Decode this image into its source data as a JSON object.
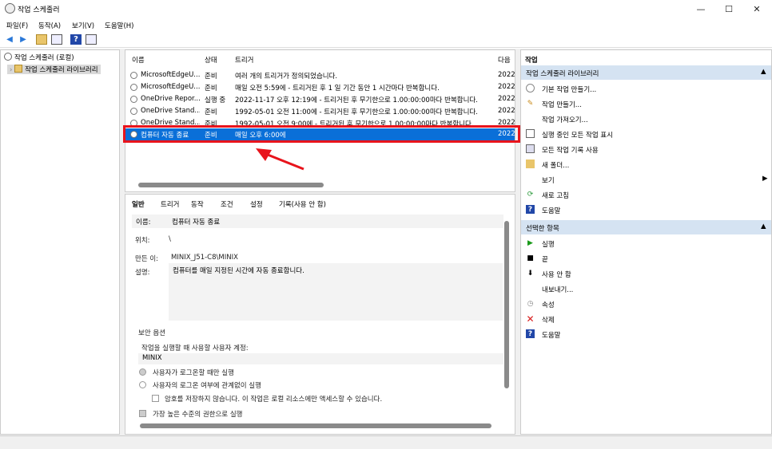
{
  "window": {
    "title": "작업 스케줄러",
    "min": "—",
    "max": "☐",
    "close": "✕"
  },
  "menu": [
    "파일(F)",
    "동작(A)",
    "보기(V)",
    "도움말(H)"
  ],
  "tree": {
    "root": "작업 스케줄러 (로컬)",
    "child": "작업 스케줄러 라이브러리"
  },
  "list": {
    "headers": {
      "name": "이름",
      "status": "상태",
      "trigger": "트리거",
      "next": "다음"
    },
    "rows": [
      {
        "name": "MicrosoftEdgeU...",
        "status": "준비",
        "trigger": "여러 개의 트리거가 정의되었습니다.",
        "next": "2022-"
      },
      {
        "name": "MicrosoftEdgeU...",
        "status": "준비",
        "trigger": "매일 오전 5:59에 - 트리거된 후 1 일 기간 동안 1 시간마다 반복합니다.",
        "next": "2022-"
      },
      {
        "name": "OneDrive Repor...",
        "status": "실행 중",
        "trigger": "2022-11-17 오후 12:19에 - 트리거된 후 무기한으로 1.00:00:00마다 반복합니다.",
        "next": "2022-"
      },
      {
        "name": "OneDrive Stand...",
        "status": "준비",
        "trigger": "1992-05-01 오전 11:00에 - 트리거된 후 무기한으로 1.00:00:00마다 반복합니다.",
        "next": "2022-"
      },
      {
        "name": "OneDrive Stand...",
        "status": "준비",
        "trigger": "1992-05-01 오전 9:00에 - 트리거된 후 무기한으로 1.00:00:00마다 반복합니다.",
        "next": "2022-"
      },
      {
        "name": "컴퓨터 자동 종료",
        "status": "준비",
        "trigger": "매일 오후 6:00에",
        "next": "2022-"
      }
    ]
  },
  "tabs": [
    "일반",
    "트리거",
    "동작",
    "조건",
    "설정",
    "기록(사용 안 함)"
  ],
  "general": {
    "name_label": "이름:",
    "name_value": "컴퓨터 자동 종료",
    "location_label": "위치:",
    "location_value": "\\",
    "author_label": "만든 이:",
    "author_value": "MINIX_J51-C8\\MINIX",
    "desc_label": "설명:",
    "desc_value": "컴퓨터를 매일 지정된 시간에 자동 종료합니다.",
    "security_title": "보안 옵션",
    "account_label": "작업을 실행할 때 사용할 사용자 계정:",
    "account_value": "MINIX",
    "opt1": "사용자가 로그온할 때만 실행",
    "opt2": "사용자의 로그온 여부에 관계없이 실행",
    "opt3": "암호를 저장하지 않습니다. 이 작업은 로컬 리소스에만 액세스할 수 있습니다.",
    "opt4": "가장 높은 수준의 권한으로 실행"
  },
  "actions": {
    "header": "작업",
    "section1": "작업 스케줄러 라이브러리",
    "items1": [
      "기본 작업 만들기...",
      "작업 만들기...",
      "작업 가져오기...",
      "실행 중인 모든 작업 표시",
      "모든 작업 기록 사용",
      "새 폴더...",
      "보기",
      "새로 고침",
      "도움말"
    ],
    "section2": "선택한 항목",
    "items2": [
      "실행",
      "끝",
      "사용 안 함",
      "내보내기...",
      "속성",
      "삭제",
      "도움말"
    ]
  },
  "colors": {
    "selection": "#0a6fd8",
    "highlight": "#e8141c",
    "section": "#d5e3f2"
  }
}
